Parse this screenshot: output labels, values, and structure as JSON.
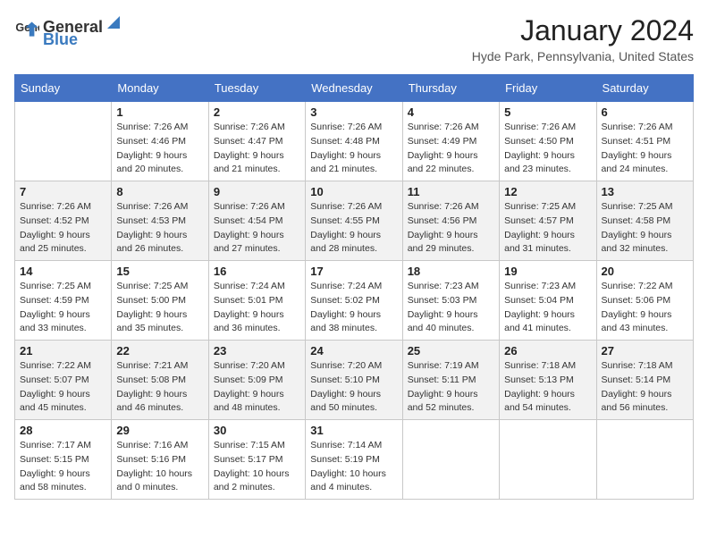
{
  "header": {
    "logo_general": "General",
    "logo_blue": "Blue",
    "month_title": "January 2024",
    "location": "Hyde Park, Pennsylvania, United States"
  },
  "days_of_week": [
    "Sunday",
    "Monday",
    "Tuesday",
    "Wednesday",
    "Thursday",
    "Friday",
    "Saturday"
  ],
  "weeks": [
    [
      {
        "day": "",
        "sunrise": "",
        "sunset": "",
        "daylight": ""
      },
      {
        "day": "1",
        "sunrise": "Sunrise: 7:26 AM",
        "sunset": "Sunset: 4:46 PM",
        "daylight": "Daylight: 9 hours and 20 minutes."
      },
      {
        "day": "2",
        "sunrise": "Sunrise: 7:26 AM",
        "sunset": "Sunset: 4:47 PM",
        "daylight": "Daylight: 9 hours and 21 minutes."
      },
      {
        "day": "3",
        "sunrise": "Sunrise: 7:26 AM",
        "sunset": "Sunset: 4:48 PM",
        "daylight": "Daylight: 9 hours and 21 minutes."
      },
      {
        "day": "4",
        "sunrise": "Sunrise: 7:26 AM",
        "sunset": "Sunset: 4:49 PM",
        "daylight": "Daylight: 9 hours and 22 minutes."
      },
      {
        "day": "5",
        "sunrise": "Sunrise: 7:26 AM",
        "sunset": "Sunset: 4:50 PM",
        "daylight": "Daylight: 9 hours and 23 minutes."
      },
      {
        "day": "6",
        "sunrise": "Sunrise: 7:26 AM",
        "sunset": "Sunset: 4:51 PM",
        "daylight": "Daylight: 9 hours and 24 minutes."
      }
    ],
    [
      {
        "day": "7",
        "sunrise": "Sunrise: 7:26 AM",
        "sunset": "Sunset: 4:52 PM",
        "daylight": "Daylight: 9 hours and 25 minutes."
      },
      {
        "day": "8",
        "sunrise": "Sunrise: 7:26 AM",
        "sunset": "Sunset: 4:53 PM",
        "daylight": "Daylight: 9 hours and 26 minutes."
      },
      {
        "day": "9",
        "sunrise": "Sunrise: 7:26 AM",
        "sunset": "Sunset: 4:54 PM",
        "daylight": "Daylight: 9 hours and 27 minutes."
      },
      {
        "day": "10",
        "sunrise": "Sunrise: 7:26 AM",
        "sunset": "Sunset: 4:55 PM",
        "daylight": "Daylight: 9 hours and 28 minutes."
      },
      {
        "day": "11",
        "sunrise": "Sunrise: 7:26 AM",
        "sunset": "Sunset: 4:56 PM",
        "daylight": "Daylight: 9 hours and 29 minutes."
      },
      {
        "day": "12",
        "sunrise": "Sunrise: 7:25 AM",
        "sunset": "Sunset: 4:57 PM",
        "daylight": "Daylight: 9 hours and 31 minutes."
      },
      {
        "day": "13",
        "sunrise": "Sunrise: 7:25 AM",
        "sunset": "Sunset: 4:58 PM",
        "daylight": "Daylight: 9 hours and 32 minutes."
      }
    ],
    [
      {
        "day": "14",
        "sunrise": "Sunrise: 7:25 AM",
        "sunset": "Sunset: 4:59 PM",
        "daylight": "Daylight: 9 hours and 33 minutes."
      },
      {
        "day": "15",
        "sunrise": "Sunrise: 7:25 AM",
        "sunset": "Sunset: 5:00 PM",
        "daylight": "Daylight: 9 hours and 35 minutes."
      },
      {
        "day": "16",
        "sunrise": "Sunrise: 7:24 AM",
        "sunset": "Sunset: 5:01 PM",
        "daylight": "Daylight: 9 hours and 36 minutes."
      },
      {
        "day": "17",
        "sunrise": "Sunrise: 7:24 AM",
        "sunset": "Sunset: 5:02 PM",
        "daylight": "Daylight: 9 hours and 38 minutes."
      },
      {
        "day": "18",
        "sunrise": "Sunrise: 7:23 AM",
        "sunset": "Sunset: 5:03 PM",
        "daylight": "Daylight: 9 hours and 40 minutes."
      },
      {
        "day": "19",
        "sunrise": "Sunrise: 7:23 AM",
        "sunset": "Sunset: 5:04 PM",
        "daylight": "Daylight: 9 hours and 41 minutes."
      },
      {
        "day": "20",
        "sunrise": "Sunrise: 7:22 AM",
        "sunset": "Sunset: 5:06 PM",
        "daylight": "Daylight: 9 hours and 43 minutes."
      }
    ],
    [
      {
        "day": "21",
        "sunrise": "Sunrise: 7:22 AM",
        "sunset": "Sunset: 5:07 PM",
        "daylight": "Daylight: 9 hours and 45 minutes."
      },
      {
        "day": "22",
        "sunrise": "Sunrise: 7:21 AM",
        "sunset": "Sunset: 5:08 PM",
        "daylight": "Daylight: 9 hours and 46 minutes."
      },
      {
        "day": "23",
        "sunrise": "Sunrise: 7:20 AM",
        "sunset": "Sunset: 5:09 PM",
        "daylight": "Daylight: 9 hours and 48 minutes."
      },
      {
        "day": "24",
        "sunrise": "Sunrise: 7:20 AM",
        "sunset": "Sunset: 5:10 PM",
        "daylight": "Daylight: 9 hours and 50 minutes."
      },
      {
        "day": "25",
        "sunrise": "Sunrise: 7:19 AM",
        "sunset": "Sunset: 5:11 PM",
        "daylight": "Daylight: 9 hours and 52 minutes."
      },
      {
        "day": "26",
        "sunrise": "Sunrise: 7:18 AM",
        "sunset": "Sunset: 5:13 PM",
        "daylight": "Daylight: 9 hours and 54 minutes."
      },
      {
        "day": "27",
        "sunrise": "Sunrise: 7:18 AM",
        "sunset": "Sunset: 5:14 PM",
        "daylight": "Daylight: 9 hours and 56 minutes."
      }
    ],
    [
      {
        "day": "28",
        "sunrise": "Sunrise: 7:17 AM",
        "sunset": "Sunset: 5:15 PM",
        "daylight": "Daylight: 9 hours and 58 minutes."
      },
      {
        "day": "29",
        "sunrise": "Sunrise: 7:16 AM",
        "sunset": "Sunset: 5:16 PM",
        "daylight": "Daylight: 10 hours and 0 minutes."
      },
      {
        "day": "30",
        "sunrise": "Sunrise: 7:15 AM",
        "sunset": "Sunset: 5:17 PM",
        "daylight": "Daylight: 10 hours and 2 minutes."
      },
      {
        "day": "31",
        "sunrise": "Sunrise: 7:14 AM",
        "sunset": "Sunset: 5:19 PM",
        "daylight": "Daylight: 10 hours and 4 minutes."
      },
      {
        "day": "",
        "sunrise": "",
        "sunset": "",
        "daylight": ""
      },
      {
        "day": "",
        "sunrise": "",
        "sunset": "",
        "daylight": ""
      },
      {
        "day": "",
        "sunrise": "",
        "sunset": "",
        "daylight": ""
      }
    ]
  ]
}
